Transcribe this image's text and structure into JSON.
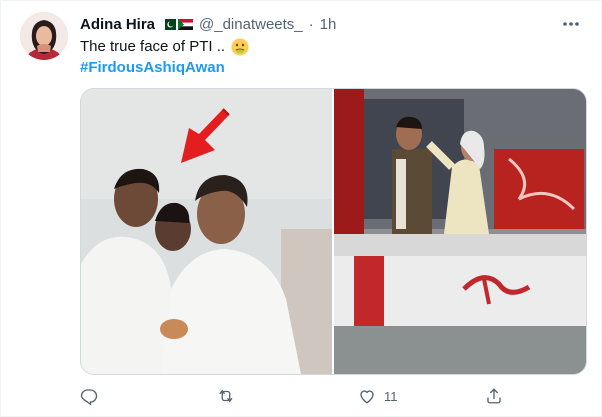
{
  "tweet": {
    "author_name": "Adina Hira",
    "handle": "@_dinatweets_",
    "separator": "·",
    "time": "1h",
    "text": "The true face of  PTI ..",
    "hashtag": "#FirdousAshiqAwan",
    "likes_count": "11"
  },
  "icons": {
    "more": "more-dots-icon",
    "reply": "reply-icon",
    "retweet": "retweet-icon",
    "like": "heart-icon",
    "share": "share-icon",
    "emoji": "nauseated-face-emoji"
  },
  "colors": {
    "accent": "#1d9bf0",
    "muted": "#536471",
    "text": "#0f1419"
  }
}
